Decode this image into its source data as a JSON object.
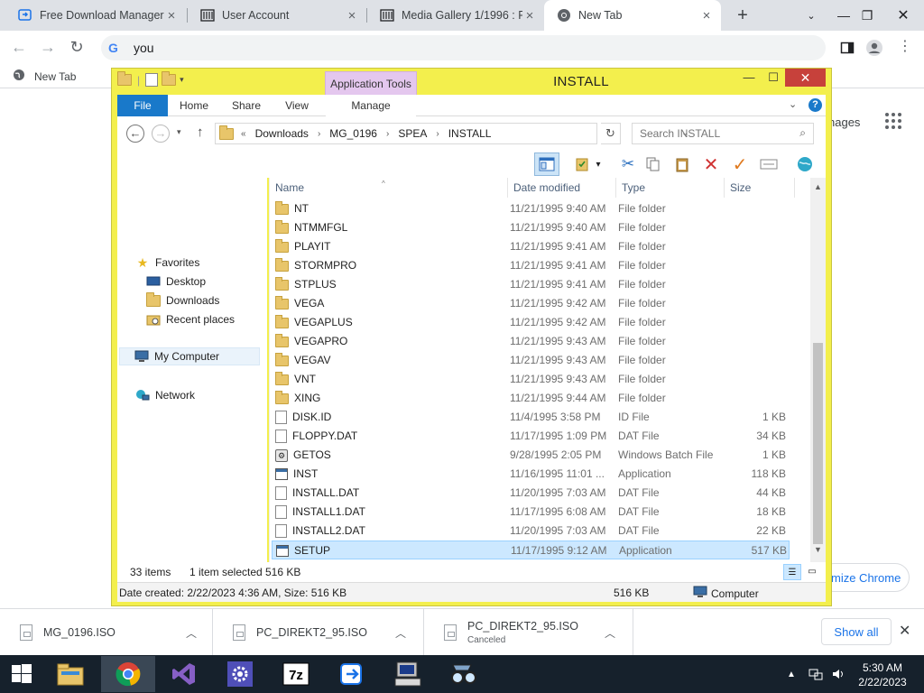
{
  "chrome": {
    "tabs": [
      {
        "title": "Free Download Manager",
        "active": false
      },
      {
        "title": "User Account",
        "active": false
      },
      {
        "title": "Media Gallery 1/1996 : Fi",
        "active": false
      },
      {
        "title": "New Tab",
        "active": true
      }
    ],
    "omnibox_value": "you",
    "bookmark": "New Tab",
    "page_images_link": "nages",
    "customize_label": "mize Chrome"
  },
  "explorer": {
    "title": "INSTALL",
    "context_tab": "Application Tools",
    "ribbon_tabs": [
      "File",
      "Home",
      "Share",
      "View",
      "Manage"
    ],
    "breadcrumb": [
      "«",
      "Downloads",
      "MG_0196",
      "SPEA",
      "INSTALL"
    ],
    "search_placeholder": "Search INSTALL",
    "nav": {
      "favorites": "Favorites",
      "desktop": "Desktop",
      "downloads": "Downloads",
      "recent": "Recent places",
      "computer": "My Computer",
      "network": "Network"
    },
    "columns": {
      "name": "Name",
      "date": "Date modified",
      "type": "Type",
      "size": "Size"
    },
    "rows": [
      {
        "name": "NT",
        "date": "11/21/1995 9:40 AM",
        "type": "File folder",
        "size": "",
        "icon": "folder"
      },
      {
        "name": "NTMMFGL",
        "date": "11/21/1995 9:40 AM",
        "type": "File folder",
        "size": "",
        "icon": "folder"
      },
      {
        "name": "PLAYIT",
        "date": "11/21/1995 9:41 AM",
        "type": "File folder",
        "size": "",
        "icon": "folder"
      },
      {
        "name": "STORMPRO",
        "date": "11/21/1995 9:41 AM",
        "type": "File folder",
        "size": "",
        "icon": "folder"
      },
      {
        "name": "STPLUS",
        "date": "11/21/1995 9:41 AM",
        "type": "File folder",
        "size": "",
        "icon": "folder"
      },
      {
        "name": "VEGA",
        "date": "11/21/1995 9:42 AM",
        "type": "File folder",
        "size": "",
        "icon": "folder"
      },
      {
        "name": "VEGAPLUS",
        "date": "11/21/1995 9:42 AM",
        "type": "File folder",
        "size": "",
        "icon": "folder"
      },
      {
        "name": "VEGAPRO",
        "date": "11/21/1995 9:43 AM",
        "type": "File folder",
        "size": "",
        "icon": "folder"
      },
      {
        "name": "VEGAV",
        "date": "11/21/1995 9:43 AM",
        "type": "File folder",
        "size": "",
        "icon": "folder"
      },
      {
        "name": "VNT",
        "date": "11/21/1995 9:43 AM",
        "type": "File folder",
        "size": "",
        "icon": "folder"
      },
      {
        "name": "XING",
        "date": "11/21/1995 9:44 AM",
        "type": "File folder",
        "size": "",
        "icon": "folder"
      },
      {
        "name": "DISK.ID",
        "date": "11/4/1995 3:58 PM",
        "type": "ID File",
        "size": "1 KB",
        "icon": "file"
      },
      {
        "name": "FLOPPY.DAT",
        "date": "11/17/1995 1:09 PM",
        "type": "DAT File",
        "size": "34 KB",
        "icon": "file"
      },
      {
        "name": "GETOS",
        "date": "9/28/1995 2:05 PM",
        "type": "Windows Batch File",
        "size": "1 KB",
        "icon": "bat"
      },
      {
        "name": "INST",
        "date": "11/16/1995 11:01 ...",
        "type": "Application",
        "size": "118 KB",
        "icon": "app"
      },
      {
        "name": "INSTALL.DAT",
        "date": "11/20/1995 7:03 AM",
        "type": "DAT File",
        "size": "44 KB",
        "icon": "file"
      },
      {
        "name": "INSTALL1.DAT",
        "date": "11/17/1995 6:08 AM",
        "type": "DAT File",
        "size": "18 KB",
        "icon": "file"
      },
      {
        "name": "INSTALL2.DAT",
        "date": "11/20/1995 7:03 AM",
        "type": "DAT File",
        "size": "22 KB",
        "icon": "file"
      },
      {
        "name": "SETUP",
        "date": "11/17/1995 9:12 AM",
        "type": "Application",
        "size": "517 KB",
        "icon": "app",
        "selected": true
      }
    ],
    "status": {
      "items": "33 items",
      "selected": "1 item selected",
      "selected_size": "516 KB",
      "details": "Date created: 2/22/2023 4:36 AM, Size: 516 KB",
      "details_size": "516 KB",
      "location": "Computer"
    }
  },
  "downloads": [
    {
      "name": "MG_0196.ISO",
      "sub": ""
    },
    {
      "name": "PC_DIREKT2_95.ISO",
      "sub": ""
    },
    {
      "name": "PC_DIREKT2_95.ISO",
      "sub": "Canceled"
    }
  ],
  "show_all": "Show all",
  "clock": {
    "time": "5:30 AM",
    "date": "2/22/2023"
  },
  "colors": {
    "explorer_frame": "#f3ef4d",
    "selection": "#cce8ff",
    "file_tab": "#1979ca"
  }
}
